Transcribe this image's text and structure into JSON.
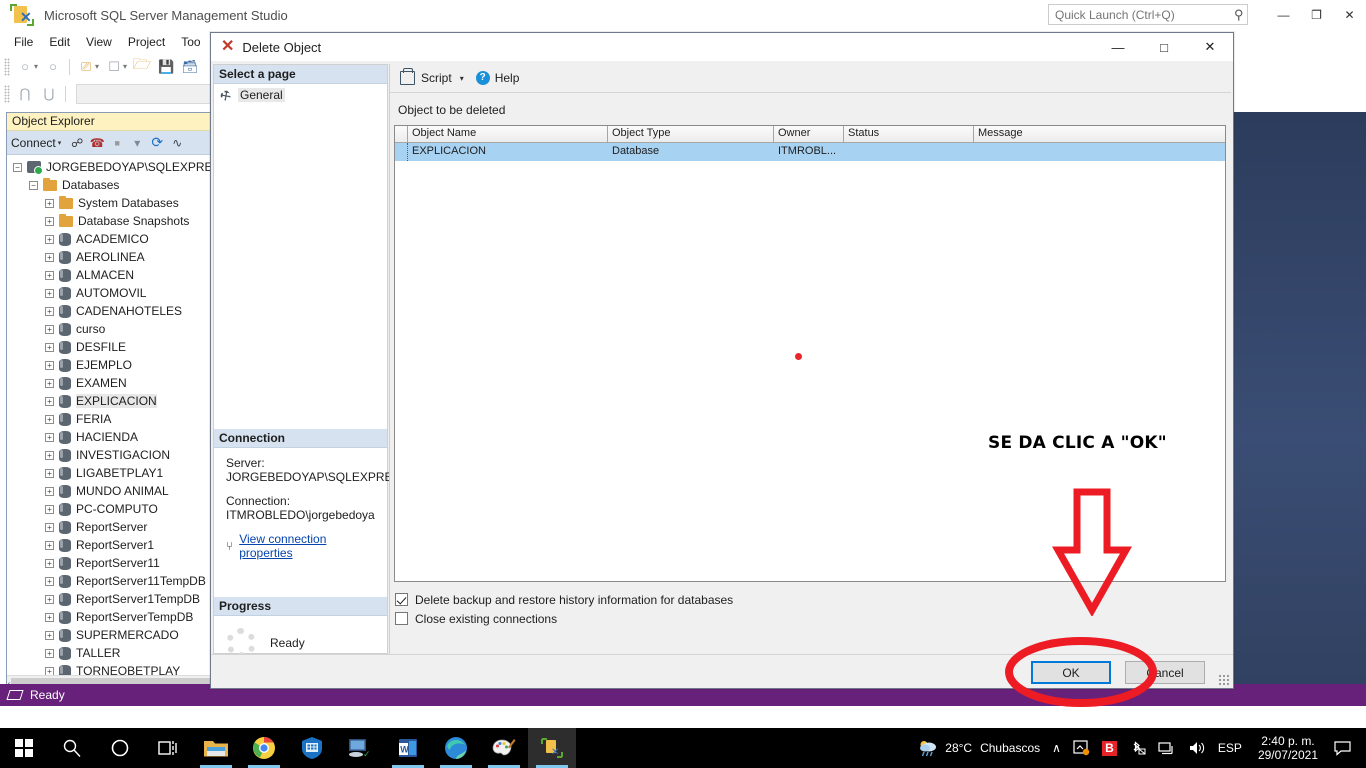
{
  "app": {
    "title": "Microsoft SQL Server Management Studio",
    "logo_icon": "ssms-logo-icon",
    "quick_launch_placeholder": "Quick Launch (Ctrl+Q)",
    "quick_launch_value": "",
    "search_icon": "search-icon",
    "minimize_icon": "minimize-icon",
    "maximize_icon": "maximize-restore-icon",
    "close_icon": "close-icon",
    "minimize_glyph": "—",
    "maximize_glyph": "❐",
    "close_glyph": "✕"
  },
  "menu": {
    "items": [
      {
        "label": "File"
      },
      {
        "label": "Edit"
      },
      {
        "label": "View"
      },
      {
        "label": "Project"
      },
      {
        "label": "Too"
      }
    ]
  },
  "toolbar": {
    "row1": [
      {
        "name": "navigate-back-icon",
        "glyph": "←"
      },
      {
        "name": "navigate-back-dropdown-icon",
        "glyph": "▾"
      },
      {
        "name": "navigate-forward-icon",
        "glyph": "→"
      },
      {
        "name": "new-query-icon",
        "glyph": "❐"
      },
      {
        "name": "new-query-dropdown-icon",
        "glyph": "▾"
      },
      {
        "name": "new-project-icon",
        "glyph": "❑"
      },
      {
        "name": "new-project-dropdown-icon",
        "glyph": "▾"
      },
      {
        "name": "open-file-icon",
        "glyph": "▱"
      },
      {
        "name": "save-icon",
        "glyph": "▣"
      },
      {
        "name": "save-all-icon",
        "glyph": "▤"
      }
    ],
    "row2": [
      {
        "name": "connect-object-explorer-icon",
        "glyph": "⑂"
      },
      {
        "name": "disconnect-object-explorer-icon",
        "glyph": "⑃"
      }
    ],
    "combo_value": ""
  },
  "object_explorer": {
    "header": "Object Explorer",
    "connect_label": "Connect",
    "connect_caret_icon": "chevron-down-icon",
    "toolbar_icons": [
      {
        "name": "connect-icon",
        "glyph": "⑂"
      },
      {
        "name": "disconnect-icon",
        "glyph": "⑃"
      },
      {
        "name": "stop-icon",
        "glyph": "■"
      },
      {
        "name": "filter-icon",
        "glyph": "▽"
      },
      {
        "name": "refresh-icon",
        "glyph": "⟳"
      },
      {
        "name": "activity-monitor-icon",
        "glyph": "⌇"
      }
    ],
    "tree": [
      {
        "label": "JORGEBEDOYAP\\SQLEXPRESS",
        "indent": 0,
        "expander": "−",
        "icon": "server-icon",
        "selected": false
      },
      {
        "label": "Databases",
        "indent": 1,
        "expander": "−",
        "icon": "folder-icon",
        "selected": false
      },
      {
        "label": "System Databases",
        "indent": 2,
        "expander": "+",
        "icon": "folder-icon",
        "selected": false
      },
      {
        "label": "Database Snapshots",
        "indent": 2,
        "expander": "+",
        "icon": "folder-icon",
        "selected": false
      },
      {
        "label": "ACADEMICO",
        "indent": 2,
        "expander": "+",
        "icon": "database-icon",
        "selected": false
      },
      {
        "label": "AEROLINEA",
        "indent": 2,
        "expander": "+",
        "icon": "database-icon",
        "selected": false
      },
      {
        "label": "ALMACEN",
        "indent": 2,
        "expander": "+",
        "icon": "database-icon",
        "selected": false
      },
      {
        "label": "AUTOMOVIL",
        "indent": 2,
        "expander": "+",
        "icon": "database-icon",
        "selected": false
      },
      {
        "label": "CADENAHOTELES",
        "indent": 2,
        "expander": "+",
        "icon": "database-icon",
        "selected": false
      },
      {
        "label": "curso",
        "indent": 2,
        "expander": "+",
        "icon": "database-icon",
        "selected": false
      },
      {
        "label": "DESFILE",
        "indent": 2,
        "expander": "+",
        "icon": "database-icon",
        "selected": false
      },
      {
        "label": "EJEMPLO",
        "indent": 2,
        "expander": "+",
        "icon": "database-icon",
        "selected": false
      },
      {
        "label": "EXAMEN",
        "indent": 2,
        "expander": "+",
        "icon": "database-icon",
        "selected": false
      },
      {
        "label": "EXPLICACION",
        "indent": 2,
        "expander": "+",
        "icon": "database-icon",
        "selected": true
      },
      {
        "label": "FERIA",
        "indent": 2,
        "expander": "+",
        "icon": "database-icon",
        "selected": false
      },
      {
        "label": "HACIENDA",
        "indent": 2,
        "expander": "+",
        "icon": "database-icon",
        "selected": false
      },
      {
        "label": "INVESTIGACION",
        "indent": 2,
        "expander": "+",
        "icon": "database-icon",
        "selected": false
      },
      {
        "label": "LIGABETPLAY1",
        "indent": 2,
        "expander": "+",
        "icon": "database-icon",
        "selected": false
      },
      {
        "label": "MUNDO ANIMAL",
        "indent": 2,
        "expander": "+",
        "icon": "database-icon",
        "selected": false
      },
      {
        "label": "PC-COMPUTO",
        "indent": 2,
        "expander": "+",
        "icon": "database-icon",
        "selected": false
      },
      {
        "label": "ReportServer",
        "indent": 2,
        "expander": "+",
        "icon": "database-icon",
        "selected": false
      },
      {
        "label": "ReportServer1",
        "indent": 2,
        "expander": "+",
        "icon": "database-icon",
        "selected": false
      },
      {
        "label": "ReportServer11",
        "indent": 2,
        "expander": "+",
        "icon": "database-icon",
        "selected": false
      },
      {
        "label": "ReportServer11TempDB",
        "indent": 2,
        "expander": "+",
        "icon": "database-icon",
        "selected": false
      },
      {
        "label": "ReportServer1TempDB",
        "indent": 2,
        "expander": "+",
        "icon": "database-icon",
        "selected": false
      },
      {
        "label": "ReportServerTempDB",
        "indent": 2,
        "expander": "+",
        "icon": "database-icon",
        "selected": false
      },
      {
        "label": "SUPERMERCADO",
        "indent": 2,
        "expander": "+",
        "icon": "database-icon",
        "selected": false
      },
      {
        "label": "TALLER",
        "indent": 2,
        "expander": "+",
        "icon": "database-icon",
        "selected": false
      },
      {
        "label": "TORNEOBETPLAY",
        "indent": 2,
        "expander": "+",
        "icon": "database-icon",
        "selected": false
      }
    ],
    "scroll_left_icon": "chevron-left-icon",
    "scroll_left_glyph": "‹"
  },
  "status_bar": {
    "text": "Ready",
    "icon": "status-shape-icon"
  },
  "dialog": {
    "title": "Delete Object",
    "title_icon": "red-x-icon",
    "title_icon_glyph": "✕",
    "minimize_glyph": "—",
    "maximize_glyph": "□",
    "close_glyph": "✕",
    "select_page_header": "Select a page",
    "pages": [
      {
        "label": "General",
        "icon": "wrench-icon",
        "icon_glyph": "⚒",
        "selected": true
      }
    ],
    "toolbar": {
      "script_label": "Script",
      "script_icon": "script-icon",
      "script_caret_icon": "chevron-down-icon",
      "script_caret_glyph": "▾",
      "help_label": "Help",
      "help_icon": "help-icon",
      "help_glyph": "?"
    },
    "object_caption": "Object to be deleted",
    "grid": {
      "columns": [
        "Object Name",
        "Object Type",
        "Owner",
        "Status",
        "Message"
      ],
      "rows": [
        {
          "object_name": "EXPLICACION",
          "object_type": "Database",
          "owner": "ITMROBL...",
          "status": "",
          "message": "",
          "selected": true
        }
      ]
    },
    "checkboxes": [
      {
        "label": "Delete backup and restore history information for databases",
        "checked": true
      },
      {
        "label": "Close existing connections",
        "checked": false
      }
    ],
    "connection": {
      "header": "Connection",
      "server_label": "Server:",
      "server_value": "JORGEBEDOYAP\\SQLEXPRESS",
      "connection_label": "Connection:",
      "connection_value": "ITMROBLEDO\\jorgebedoya",
      "view_properties_link": "View connection properties",
      "view_properties_icon": "connection-properties-icon",
      "view_properties_glyph": "⑂"
    },
    "progress": {
      "header": "Progress",
      "status": "Ready",
      "spinner_icon": "progress-spinner-icon"
    },
    "buttons": {
      "ok": "OK",
      "cancel": "Cancel"
    },
    "resize_grip_icon": "resize-grip-icon"
  },
  "annotations": {
    "instruction_text": "SE DA CLIC A \"OK\"",
    "arrow_icon": "red-down-arrow-annotation",
    "circle_icon": "red-ellipse-annotation",
    "dot_icon": "red-dot-marker",
    "color": "#e8262c"
  },
  "taskbar": {
    "items": [
      {
        "name": "start-button-icon",
        "label": "Start"
      },
      {
        "name": "search-icon",
        "label": "Search"
      },
      {
        "name": "cortana-icon",
        "label": "Cortana"
      },
      {
        "name": "task-view-icon",
        "label": "Task View"
      },
      {
        "name": "file-explorer-icon",
        "label": "File Explorer"
      },
      {
        "name": "google-chrome-icon",
        "label": "Google Chrome"
      },
      {
        "name": "windows-security-icon",
        "label": "Windows Security"
      },
      {
        "name": "remote-desktop-icon",
        "label": "Remote Desktop"
      },
      {
        "name": "microsoft-word-icon",
        "label": "Microsoft Word"
      },
      {
        "name": "microsoft-edge-icon",
        "label": "Microsoft Edge"
      },
      {
        "name": "paint-icon",
        "label": "Paint"
      },
      {
        "name": "ssms-taskbar-icon",
        "label": "SQL Server Management Studio"
      }
    ],
    "tray": {
      "weather_temp": "28°C",
      "weather_desc": "Chubascos",
      "weather_icon": "weather-rain-icon",
      "show_hidden_icon": "chevron-up-icon",
      "show_hidden_glyph": "∧",
      "onedrive_icon": "onedrive-sync-icon",
      "bitdefender_icon": "bitdefender-icon",
      "bitdefender_glyph": "B",
      "bluetooth_icon": "bluetooth-off-icon",
      "network_icon": "network-icon",
      "volume_icon": "volume-icon",
      "volume_glyph": "🔊",
      "language": "ESP",
      "time": "2:40 p. m.",
      "date": "29/07/2021",
      "action_center_icon": "action-center-icon",
      "action_center_glyph": "▭"
    }
  }
}
